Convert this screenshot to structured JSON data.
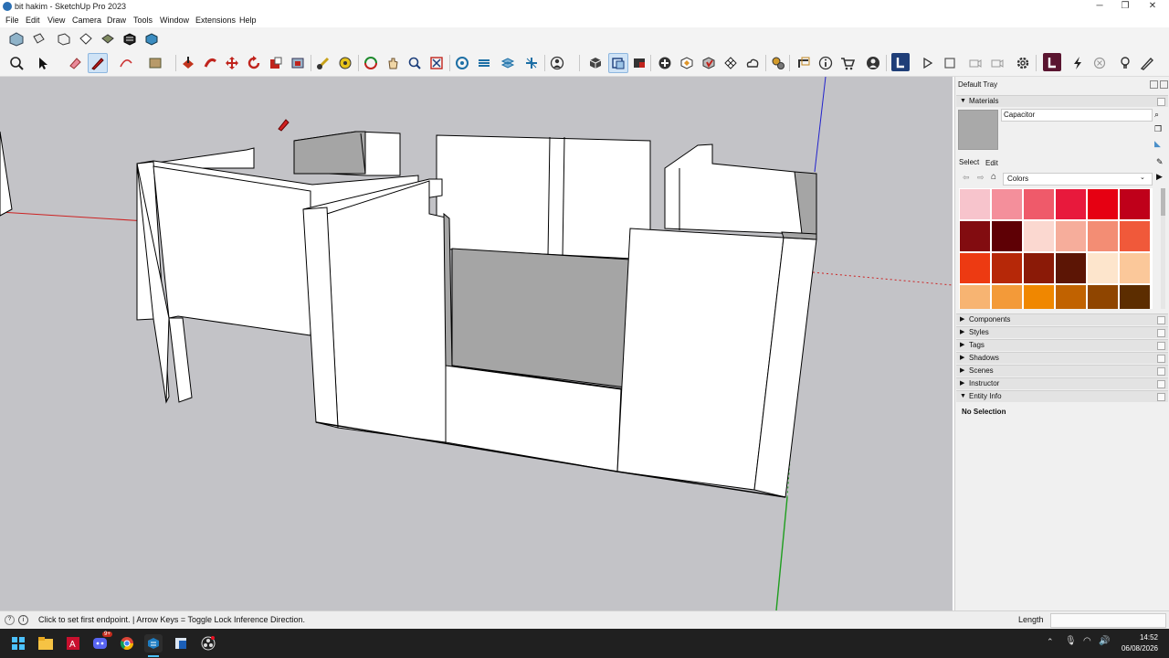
{
  "window": {
    "title": "bit hakim - SketchUp Pro 2023",
    "minimize": "─",
    "restore": "❐",
    "close": "✕"
  },
  "menu": [
    "File",
    "Edit",
    "View",
    "Camera",
    "Draw",
    "Tools",
    "Window",
    "Extensions",
    "Help"
  ],
  "toolbar_row1_icons": [
    "iso-view-icon",
    "top-view-icon",
    "front-view-icon",
    "right-view-icon",
    "back-view-icon",
    "left-view-icon",
    "bottom-view-icon"
  ],
  "toolbar_row2_icons": [
    "zoom-icon",
    "select-icon",
    "eraser-icon",
    "pencil-line-icon",
    "arc-icon",
    "rectangle-icon",
    "push-pull-icon",
    "follow-me-icon",
    "move-icon",
    "rotate-icon",
    "scale-icon",
    "offset-icon",
    "tape-measure-icon",
    "paint-bucket-icon",
    "orbit-icon",
    "pan-icon",
    "zoom-window-icon",
    "zoom-extents-icon",
    "section-plane-icon",
    "layers-icon",
    "styles-icon",
    "axes-icon",
    "user-icon",
    "component-icon",
    "outliner-icon",
    "scene-icon",
    "add-location-icon",
    "3d-warehouse-icon",
    "extension-icon",
    "solid-tools-icon",
    "trimble-connect-icon",
    "settings-icon",
    "dimension-icon",
    "info-icon",
    "cart-icon",
    "account-icon",
    "layout-icon",
    "play-icon",
    "stop-icon",
    "camera-icon",
    "video-icon",
    "gear-icon",
    "ruby-icon",
    "flash-icon",
    "cancel-icon",
    "bulb-icon",
    "pen-icon"
  ],
  "tray": {
    "title": "Default Tray",
    "materials": {
      "header": "Materials",
      "material_name": "Capacitor",
      "tab_select": "Select",
      "tab_edit": "Edit",
      "library": "Colors",
      "swatch_colors": [
        "#f7c4cc",
        "#f48f9b",
        "#ef5a6a",
        "#e8193c",
        "#e60012",
        "#bf001a",
        "#820c10",
        "#5e0005",
        "#fbd8d0",
        "#f6ad9b",
        "#f38d74",
        "#f0593a",
        "#ed3a12",
        "#b62808",
        "#8b1a07",
        "#5c1505",
        "#fde5cc",
        "#fbc89a",
        "#f7b472",
        "#f39a39",
        "#f08700",
        "#c16200",
        "#8f4500",
        "#5c2d00"
      ],
      "selected_color": "#a9a9a9"
    },
    "panels": [
      "Components",
      "Styles",
      "Tags",
      "Shadows",
      "Scenes",
      "Instructor",
      "Entity Info"
    ],
    "entity_info": {
      "selection": "No Selection"
    }
  },
  "status": {
    "hint": "Click to set first endpoint. | Arrow Keys = Toggle Lock Inference Direction.",
    "measurement_label": "Length",
    "measurement_value": ""
  },
  "taskbar": {
    "icons": [
      "windows-start-icon",
      "file-explorer-icon",
      "autocad-icon",
      "discord-icon",
      "chrome-icon",
      "sketchup-icon",
      "app-icon",
      "obs-icon"
    ],
    "discord_badge": "9+",
    "time": "14:52",
    "date": "06/08/2026"
  },
  "colors": {
    "viewport_bg": "#c3c3c7",
    "face_light": "#ffffff",
    "face_shadow": "#a5a5a5",
    "axis_red": "#cc2222",
    "axis_green": "#1e9e1e",
    "axis_blue": "#2222cc"
  }
}
